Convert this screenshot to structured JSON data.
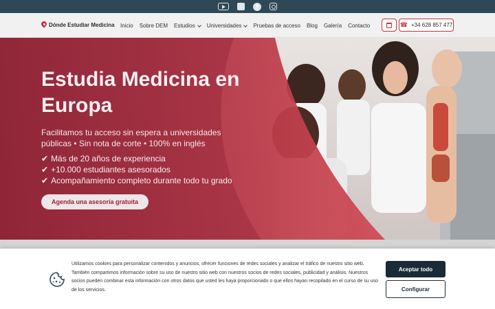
{
  "social": {
    "icons": [
      "youtube-icon",
      "tiktok-icon",
      "facebook-icon",
      "instagram-icon"
    ]
  },
  "nav": {
    "brand": "Dónde Estudiar Medicina",
    "items": [
      {
        "label": "Inicio",
        "dropdown": false
      },
      {
        "label": "Sobre DEM",
        "dropdown": false
      },
      {
        "label": "Estudios",
        "dropdown": true
      },
      {
        "label": "Universidades",
        "dropdown": true
      },
      {
        "label": "Pruebas de acceso",
        "dropdown": false
      },
      {
        "label": "Blog",
        "dropdown": false
      },
      {
        "label": "Galería",
        "dropdown": false
      },
      {
        "label": "Contacto",
        "dropdown": false
      }
    ],
    "phone": "+34 628 857 477"
  },
  "hero": {
    "title": "Estudia Medicina en Europa",
    "subtitle": "Facilitamos tu acceso sin espera a universidades públicas • Sin nota de corte • 100% en inglés",
    "bullets": [
      "Más de 20 años de experiencia",
      "+10.000 estudiantes asesorados",
      "Acompañamiento completo durante todo tu grado"
    ],
    "check": "✔",
    "cta": "Agenda una asesoría gratuita"
  },
  "cookie": {
    "text": "Utilizamos cookies para personalizar contenidos y anuncios, ofrecer funciones de redes sociales y analizar el tráfico de nuestro sitio web. También compartimos información sobre su uso de nuestro sitio web con nuestros socios de redes sociales, publicidad y análisis. Nuestros socios pueden combinar esta información con otros datos que usted les haya proporcionado o que ellos hayan recopilado en el curso de su uso de los servicios.",
    "accept": "Aceptar todo",
    "configure": "Configurar"
  },
  "colors": {
    "topbar": "#2e4856",
    "accent": "#c8323f",
    "hero_overlay": "#9b2234",
    "dark_button": "#1b2a37"
  }
}
